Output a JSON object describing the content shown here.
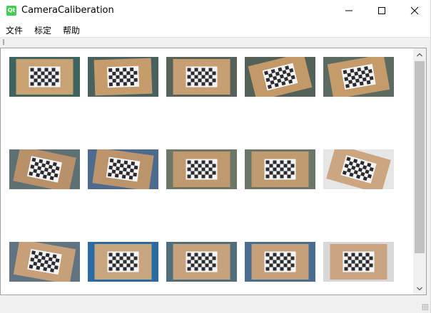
{
  "window": {
    "title": "CameraCaliberation",
    "app_icon_text": "Qt"
  },
  "window_controls": {
    "minimize": "minimize",
    "maximize": "maximize",
    "close": "close"
  },
  "menubar": {
    "items": [
      "文件",
      "标定",
      "帮助"
    ]
  },
  "images": [
    {
      "tint": "#c9a273",
      "bg": "#3f6460",
      "angle": 0
    },
    {
      "tint": "#c69c6c",
      "bg": "#4a625f",
      "angle": -2
    },
    {
      "tint": "#c89f72",
      "bg": "#56625a",
      "angle": 0
    },
    {
      "tint": "#c39967",
      "bg": "#546159",
      "angle": -14
    },
    {
      "tint": "#c49b69",
      "bg": "#5c6b61",
      "angle": -10
    },
    {
      "tint": "#b8916a",
      "bg": "#5d7072",
      "angle": 12
    },
    {
      "tint": "#bb946b",
      "bg": "#4d6b8e",
      "angle": 8
    },
    {
      "tint": "#c09a6e",
      "bg": "#6b7666",
      "angle": 0
    },
    {
      "tint": "#c19b70",
      "bg": "#6a7668",
      "angle": 0
    },
    {
      "tint": "#cba680",
      "bg": "#e6e6e6",
      "angle": 16
    },
    {
      "tint": "#c7a07a",
      "bg": "#5f7380",
      "angle": 10
    },
    {
      "tint": "#c8a57f",
      "bg": "#2b6ba3",
      "angle": 0
    },
    {
      "tint": "#c7a27c",
      "bg": "#4e6f7b",
      "angle": 0
    },
    {
      "tint": "#c6a07a",
      "bg": "#496c8f",
      "angle": 0
    },
    {
      "tint": "#caa381",
      "bg": "#d8d8d8",
      "angle": 0
    }
  ],
  "colors": {
    "accent_qt": "#41cd52"
  }
}
